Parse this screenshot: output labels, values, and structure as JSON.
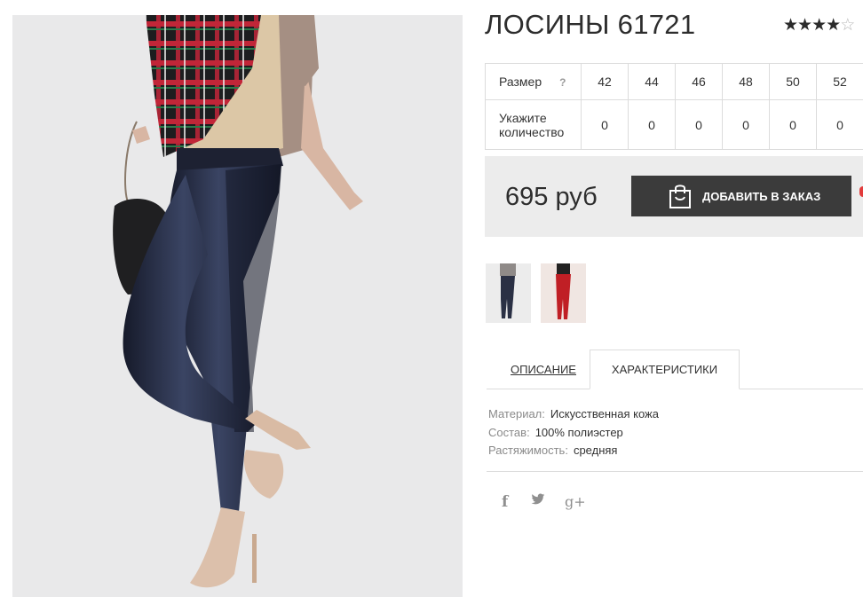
{
  "product": {
    "title": "ЛОСИНЫ 61721",
    "rating": 4,
    "rating_max": 5
  },
  "sizes": {
    "size_label": "Размер",
    "help_label": "?",
    "quantity_label": "Укажите количество",
    "values": [
      "42",
      "44",
      "46",
      "48",
      "50",
      "52"
    ],
    "quantities": [
      "0",
      "0",
      "0",
      "0",
      "0",
      "0"
    ]
  },
  "purchase": {
    "price": "695 руб",
    "button_label": "ДОБАВИТЬ В ЗАКАЗ",
    "button_icon": "shopping-bag-icon"
  },
  "thumbnails": [
    {
      "alt": "navy leggings",
      "color": "#1f2437"
    },
    {
      "alt": "red leggings",
      "color": "#c01f25"
    }
  ],
  "tabs": {
    "description": "ОПИСАНИЕ",
    "characteristics": "ХАРАКТЕРИСТИКИ",
    "active": "characteristics"
  },
  "specs": [
    {
      "key": "Материал:",
      "value": "Искусственная кожа"
    },
    {
      "key": "Состав:",
      "value": "100% полиэстер"
    },
    {
      "key": "Растяжимость:",
      "value": "средняя"
    }
  ],
  "social": {
    "facebook": "f",
    "twitter": "twitter-icon",
    "google_plus": "g+"
  },
  "colors": {
    "button_bg": "#3b3b3b",
    "price_bg": "#ececec",
    "leggings": "#1f2437"
  }
}
